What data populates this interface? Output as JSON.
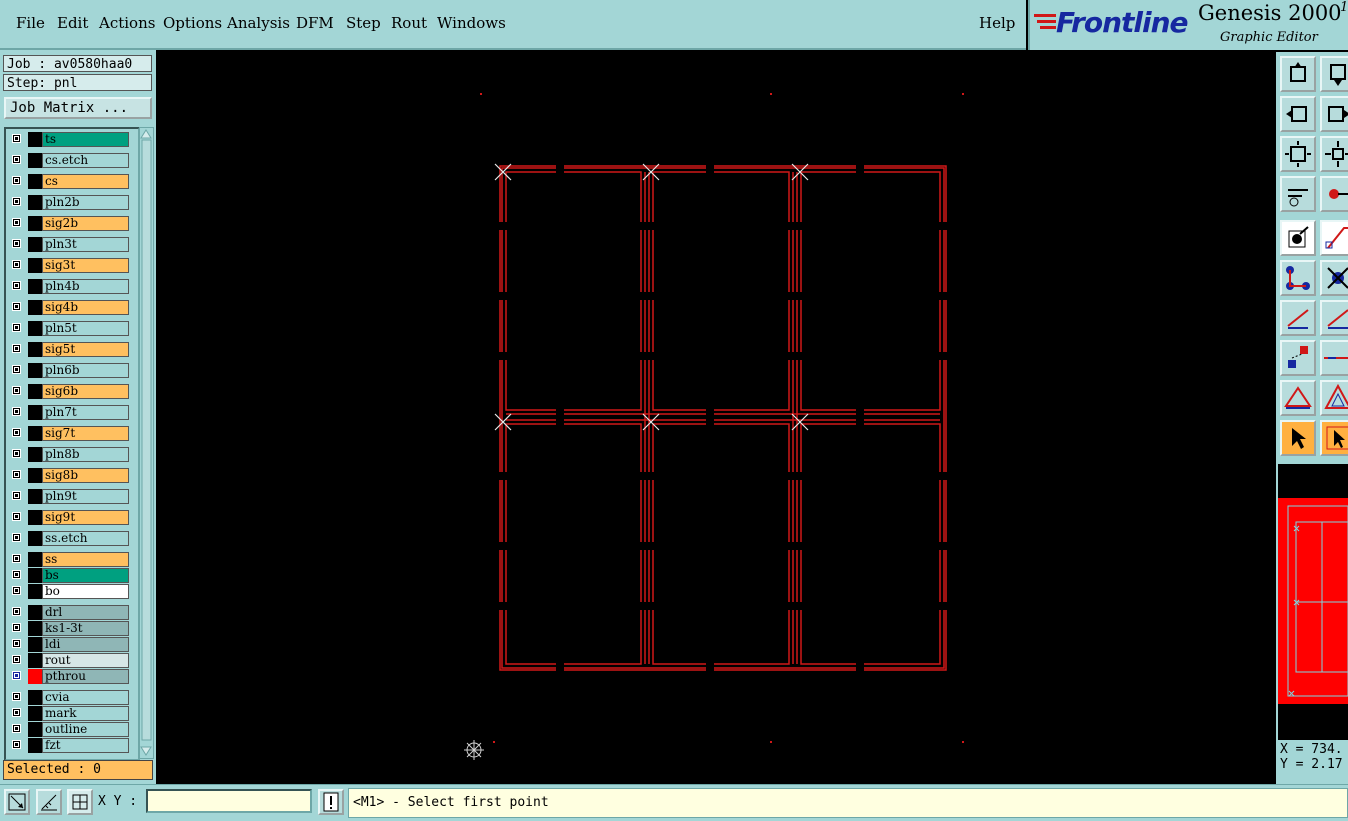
{
  "menu": {
    "file": "File",
    "edit": "Edit",
    "actions": "Actions",
    "options": "Options",
    "analysis": "Analysis",
    "dfm": "DFM",
    "step": "Step",
    "rout": "Rout",
    "windows": "Windows",
    "help": "Help"
  },
  "brand": {
    "frontline": "Frontline",
    "product": "Genesis 2000",
    "superscript": "1",
    "subtitle": "Graphic Editor"
  },
  "job": {
    "job_text": "Job : av0580haa0",
    "step_text": "Step: pnl"
  },
  "job_matrix_label": "Job Matrix ...",
  "layers": [
    {
      "name": "ts",
      "color": "#00a080"
    },
    {
      "name": "cs.etch",
      "color": "#a3d6d6"
    },
    {
      "name": "cs",
      "color": "#ffc060"
    },
    {
      "name": "pln2b",
      "color": "#a3d6d6"
    },
    {
      "name": "sig2b",
      "color": "#ffc060"
    },
    {
      "name": "pln3t",
      "color": "#a3d6d6"
    },
    {
      "name": "sig3t",
      "color": "#ffc060"
    },
    {
      "name": "pln4b",
      "color": "#a3d6d6"
    },
    {
      "name": "sig4b",
      "color": "#ffc060"
    },
    {
      "name": "pln5t",
      "color": "#a3d6d6"
    },
    {
      "name": "sig5t",
      "color": "#ffc060"
    },
    {
      "name": "pln6b",
      "color": "#a3d6d6"
    },
    {
      "name": "sig6b",
      "color": "#ffc060"
    },
    {
      "name": "pln7t",
      "color": "#a3d6d6"
    },
    {
      "name": "sig7t",
      "color": "#ffc060"
    },
    {
      "name": "pln8b",
      "color": "#a3d6d6"
    },
    {
      "name": "sig8b",
      "color": "#ffc060"
    },
    {
      "name": "pln9t",
      "color": "#a3d6d6"
    },
    {
      "name": "sig9t",
      "color": "#ffc060"
    },
    {
      "name": "ss.etch",
      "color": "#a3d6d6"
    },
    {
      "name": "ss",
      "color": "#ffc060"
    },
    {
      "name": "bs",
      "color": "#00a080"
    },
    {
      "name": "bo",
      "color": "#ffffff"
    },
    {
      "name": "drl",
      "color": "#8fb6b6"
    },
    {
      "name": "ks1-3t",
      "color": "#8fb6b6"
    },
    {
      "name": "ldi",
      "color": "#8fb6b6"
    },
    {
      "name": "rout",
      "color": "#d6e6e6"
    },
    {
      "name": "pthrou",
      "color": "#8fb6b6"
    },
    {
      "name": "cvia",
      "color": "#a3d6d6"
    },
    {
      "name": "mark",
      "color": "#a3d6d6"
    },
    {
      "name": "outline",
      "color": "#a3d6d6"
    },
    {
      "name": "fzt",
      "color": "#a3d6d6"
    }
  ],
  "selected_text": "Selected : 0",
  "coords": {
    "x_text": "X = 734.",
    "y_text": "Y = 2.17"
  },
  "xy_label": "X Y :",
  "xy_input_value": "",
  "status_message": "<M1> - Select first point",
  "colors": {
    "panel": "#a3d6d6",
    "board_outline": "#d01818",
    "canvas": "#000000",
    "active_layer": "#ffc060"
  }
}
